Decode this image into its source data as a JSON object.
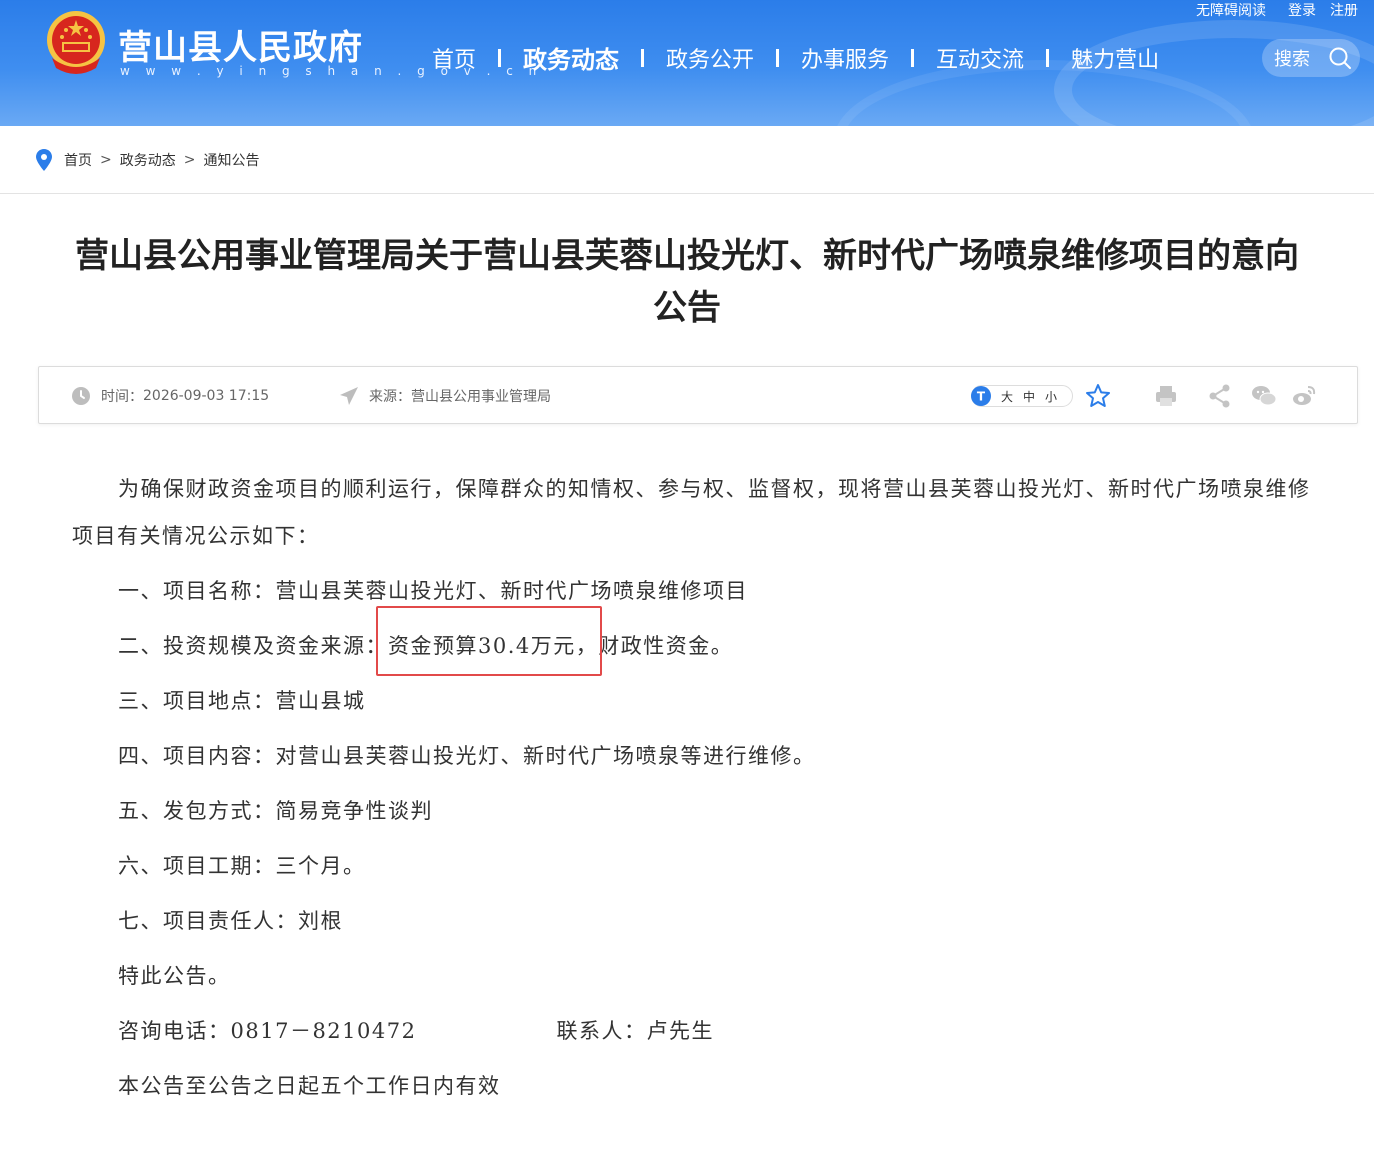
{
  "header": {
    "site_title": "营山县人民政府",
    "site_url": "w w w . y i n g s h a n . g o v . c n",
    "top_links": {
      "accessibility": "无障碍阅读",
      "login": "登录",
      "register": "注册"
    },
    "nav": [
      {
        "label": "首页",
        "active": false
      },
      {
        "label": "政务动态",
        "active": true
      },
      {
        "label": "政务公开",
        "active": false
      },
      {
        "label": "办事服务",
        "active": false
      },
      {
        "label": "互动交流",
        "active": false
      },
      {
        "label": "魅力营山",
        "active": false
      }
    ],
    "search_label": "搜索",
    "colors": {
      "header_blue": "#2b7de9",
      "highlight_red": "#e24a4a"
    }
  },
  "breadcrumb": {
    "items": [
      "首页",
      "政务动态",
      "通知公告"
    ],
    "separator": ">"
  },
  "article": {
    "title": "营山县公用事业管理局关于营山县芙蓉山投光灯、新时代广场喷泉维修项目的意向公告",
    "meta": {
      "time_label": "时间：",
      "time_value": "2026-09-03 17:15",
      "source_label": "来源：",
      "source_value": "营山县公用事业管理局",
      "font_sizes": [
        "大",
        "中",
        "小"
      ]
    },
    "intro": "为确保财政资金项目的顺利运行，保障群众的知情权、参与权、监督权，现将营山县芙蓉山投光灯、新时代广场喷泉维修项目有关情况公示如下：",
    "lines": [
      "一、项目名称：营山县芙蓉山投光灯、新时代广场喷泉维修项目",
      "二、投资规模及资金来源：资金预算30.4万元，财政性资金。",
      "三、项目地点：营山县城",
      "四、项目内容：对营山县芙蓉山投光灯、新时代广场喷泉等进行维修。",
      "五、发包方式：简易竞争性谈判",
      "六、项目工期：三个月。",
      "七、项目责任人：刘根",
      "特此公告。"
    ],
    "phone_label": "咨询电话：0817－8210472",
    "contact_label": "联系人：卢先生",
    "closing": "本公告至公告之日起五个工作日内有效"
  }
}
